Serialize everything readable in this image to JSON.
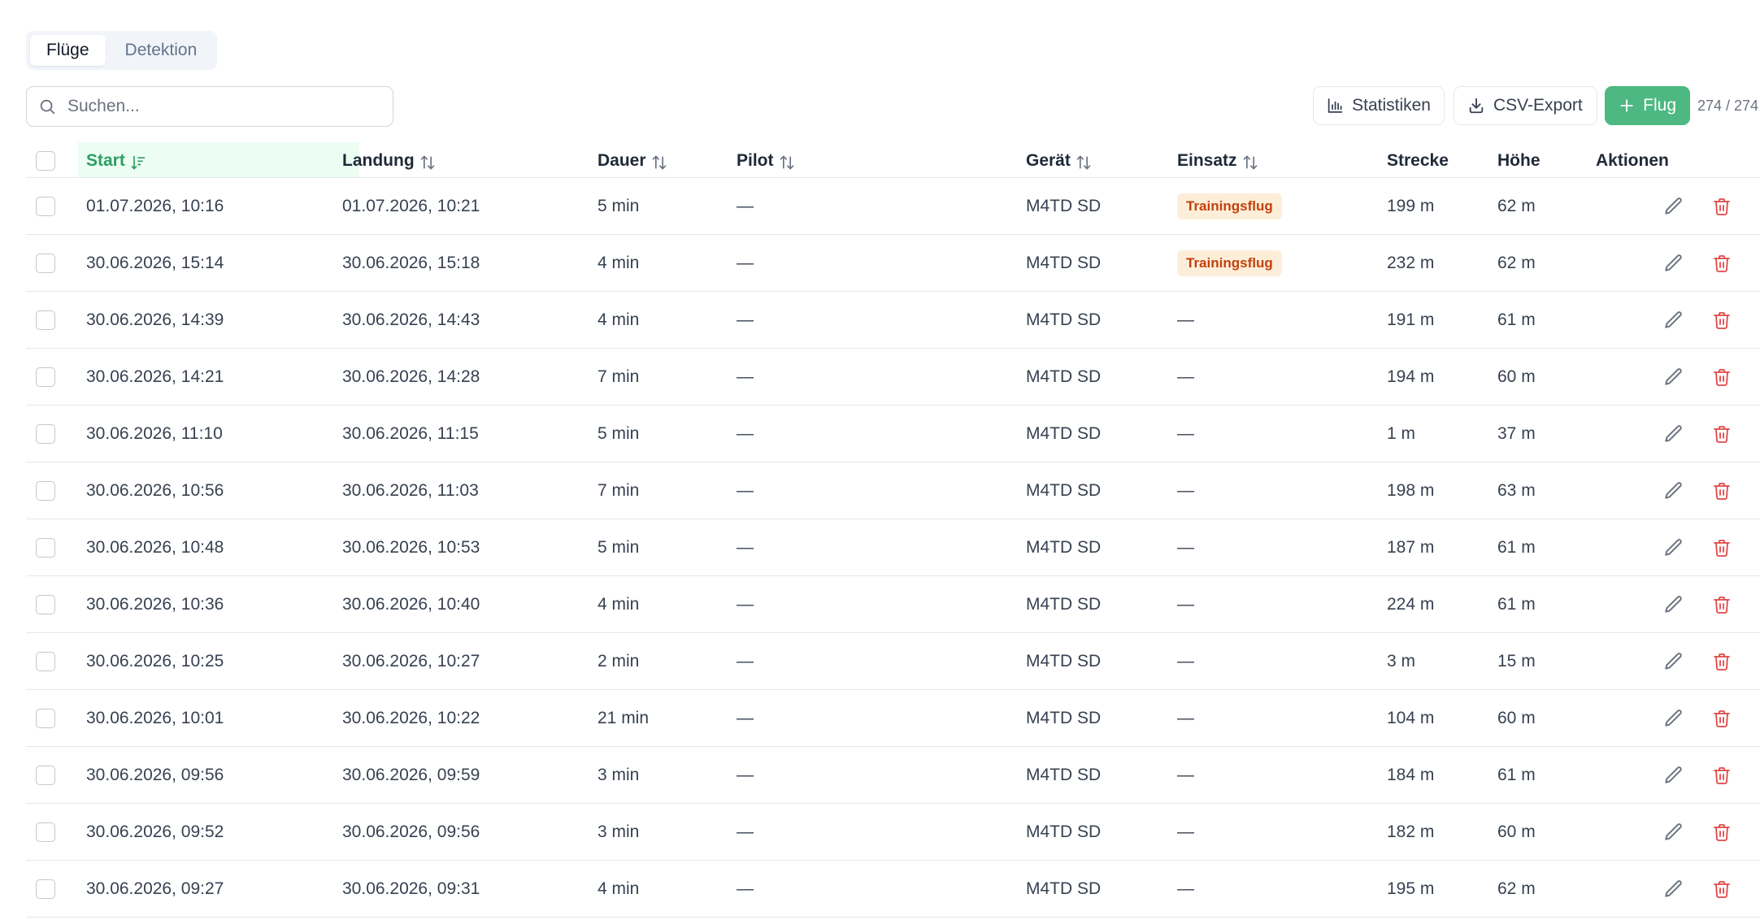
{
  "tabs": [
    {
      "label": "Flüge",
      "active": true
    },
    {
      "label": "Detektion",
      "active": false
    }
  ],
  "search": {
    "placeholder": "Suchen...",
    "value": ""
  },
  "toolbar": {
    "stats_label": "Statistiken",
    "csv_label": "CSV-Export",
    "add_label": "Flug",
    "count": "274 / 274"
  },
  "colors": {
    "accent": "#4db882",
    "sorted_header_bg": "#ecfdf3",
    "sorted_header_text": "#2f9e63",
    "badge_bg": "#fdeed9",
    "badge_text": "#c2410c",
    "delete_icon": "#e04848"
  },
  "table": {
    "columns": {
      "start": "Start",
      "landing": "Landung",
      "duration": "Dauer",
      "pilot": "Pilot",
      "device": "Gerät",
      "mission": "Einsatz",
      "distance": "Strecke",
      "height": "Höhe",
      "actions": "Aktionen"
    },
    "sorted_by": "start",
    "rows": [
      {
        "start": "01.07.2026, 10:16",
        "landing": "01.07.2026, 10:21",
        "duration": "5 min",
        "pilot": "—",
        "device": "M4TD SD",
        "mission": "Trainingsflug",
        "distance": "199 m",
        "height": "62 m"
      },
      {
        "start": "30.06.2026, 15:14",
        "landing": "30.06.2026, 15:18",
        "duration": "4 min",
        "pilot": "—",
        "device": "M4TD SD",
        "mission": "Trainingsflug",
        "distance": "232 m",
        "height": "62 m"
      },
      {
        "start": "30.06.2026, 14:39",
        "landing": "30.06.2026, 14:43",
        "duration": "4 min",
        "pilot": "—",
        "device": "M4TD SD",
        "mission": "—",
        "distance": "191 m",
        "height": "61 m"
      },
      {
        "start": "30.06.2026, 14:21",
        "landing": "30.06.2026, 14:28",
        "duration": "7 min",
        "pilot": "—",
        "device": "M4TD SD",
        "mission": "—",
        "distance": "194 m",
        "height": "60 m"
      },
      {
        "start": "30.06.2026, 11:10",
        "landing": "30.06.2026, 11:15",
        "duration": "5 min",
        "pilot": "—",
        "device": "M4TD SD",
        "mission": "—",
        "distance": "1 m",
        "height": "37 m"
      },
      {
        "start": "30.06.2026, 10:56",
        "landing": "30.06.2026, 11:03",
        "duration": "7 min",
        "pilot": "—",
        "device": "M4TD SD",
        "mission": "—",
        "distance": "198 m",
        "height": "63 m"
      },
      {
        "start": "30.06.2026, 10:48",
        "landing": "30.06.2026, 10:53",
        "duration": "5 min",
        "pilot": "—",
        "device": "M4TD SD",
        "mission": "—",
        "distance": "187 m",
        "height": "61 m"
      },
      {
        "start": "30.06.2026, 10:36",
        "landing": "30.06.2026, 10:40",
        "duration": "4 min",
        "pilot": "—",
        "device": "M4TD SD",
        "mission": "—",
        "distance": "224 m",
        "height": "61 m"
      },
      {
        "start": "30.06.2026, 10:25",
        "landing": "30.06.2026, 10:27",
        "duration": "2 min",
        "pilot": "—",
        "device": "M4TD SD",
        "mission": "—",
        "distance": "3 m",
        "height": "15 m"
      },
      {
        "start": "30.06.2026, 10:01",
        "landing": "30.06.2026, 10:22",
        "duration": "21 min",
        "pilot": "—",
        "device": "M4TD SD",
        "mission": "—",
        "distance": "104 m",
        "height": "60 m"
      },
      {
        "start": "30.06.2026, 09:56",
        "landing": "30.06.2026, 09:59",
        "duration": "3 min",
        "pilot": "—",
        "device": "M4TD SD",
        "mission": "—",
        "distance": "184 m",
        "height": "61 m"
      },
      {
        "start": "30.06.2026, 09:52",
        "landing": "30.06.2026, 09:56",
        "duration": "3 min",
        "pilot": "—",
        "device": "M4TD SD",
        "mission": "—",
        "distance": "182 m",
        "height": "60 m"
      },
      {
        "start": "30.06.2026, 09:27",
        "landing": "30.06.2026, 09:31",
        "duration": "4 min",
        "pilot": "—",
        "device": "M4TD SD",
        "mission": "—",
        "distance": "195 m",
        "height": "62 m"
      }
    ]
  }
}
